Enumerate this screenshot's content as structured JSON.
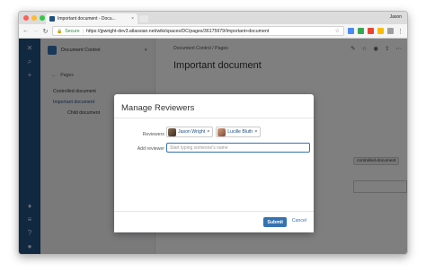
{
  "browser": {
    "tab_title": "Important document - Docu...",
    "tab_close": "×",
    "profile_name": "Jason",
    "secure_label": "Secure",
    "url": "https://jpwright-dev3.atlassian.net/wiki/spaces/DC/pages/36175979/Important+document",
    "nav": {
      "back": "←",
      "forward": "→",
      "reload": "↻"
    },
    "colors": {
      "traffic_red": "#fc5f57",
      "traffic_yellow": "#fdbc2e",
      "traffic_green": "#33c748"
    }
  },
  "rail": {
    "icons": [
      "confluence-logo-icon",
      "search-icon",
      "create-icon",
      "notifications-icon",
      "menu-icon",
      "help-icon",
      "user-avatar-icon"
    ],
    "brand_color": "#205081"
  },
  "sidebar": {
    "space_name": "Document Control",
    "pages_heading": "Pages",
    "tree": [
      {
        "label": "Controlled document"
      },
      {
        "label": "Important document"
      },
      {
        "label": "Child document"
      }
    ]
  },
  "content": {
    "breadcrumb": "Document Control  /  Pages",
    "title": "Important document",
    "label_tag": "controlled-document"
  },
  "dialog": {
    "title": "Manage Reviewers",
    "reviewers_label": "Reviewers",
    "add_reviewer_label": "Add reviewer",
    "add_reviewer_placeholder": "Start typing someone's name",
    "reviewers": [
      {
        "name": "Jason Wright"
      },
      {
        "name": "Lucille Bluth"
      }
    ],
    "remove_glyph": "×",
    "submit_label": "Submit",
    "cancel_label": "Cancel",
    "accent_color": "#3572b0"
  }
}
